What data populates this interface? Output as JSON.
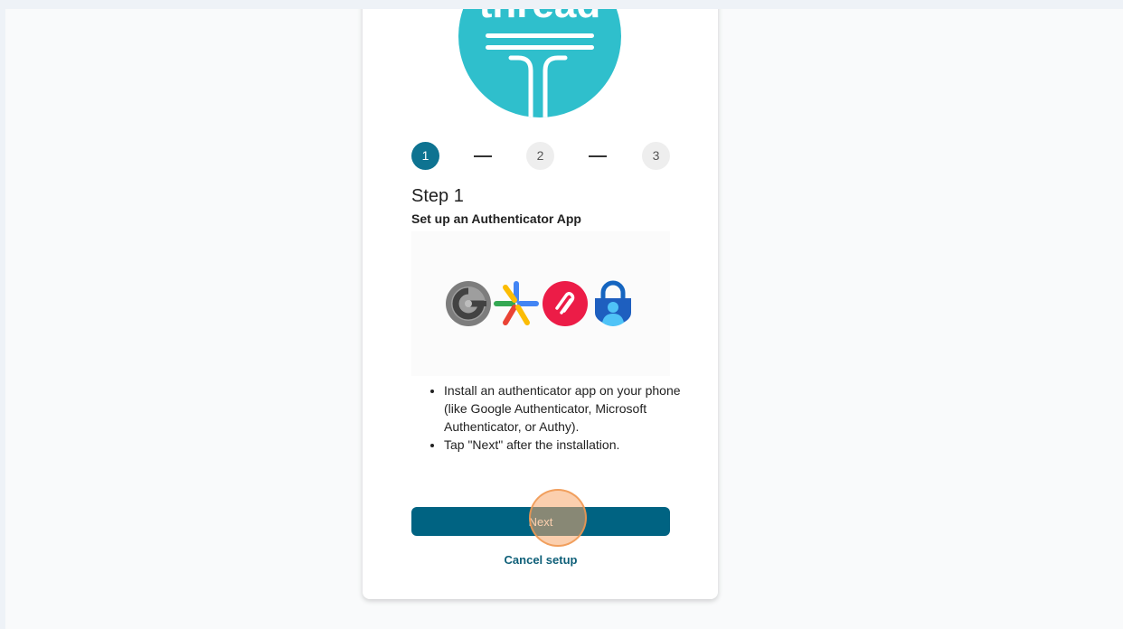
{
  "logo": {
    "brand_text": "thread",
    "color": "#2fbfcc"
  },
  "stepper": {
    "steps": [
      {
        "label": "1",
        "state": "active"
      },
      {
        "label": "2",
        "state": "inactive"
      },
      {
        "label": "3",
        "state": "inactive"
      }
    ],
    "active_color": "#0e7391"
  },
  "step": {
    "title": "Step 1",
    "subtitle": "Set up an Authenticator App"
  },
  "authenticator_apps": [
    {
      "name": "Google Authenticator (legacy)",
      "icon": "google-authenticator-legacy-icon"
    },
    {
      "name": "Google Authenticator",
      "icon": "google-authenticator-icon"
    },
    {
      "name": "Authy",
      "icon": "authy-icon"
    },
    {
      "name": "Microsoft Authenticator",
      "icon": "microsoft-authenticator-icon"
    }
  ],
  "instructions": [
    "Install an authenticator app on your phone (like Google Authenticator, Microsoft Authenticator, or Authy).",
    "Tap \"Next\" after the installation."
  ],
  "actions": {
    "next_label": "Next",
    "cancel_label": "Cancel setup",
    "primary_color": "#006382"
  }
}
